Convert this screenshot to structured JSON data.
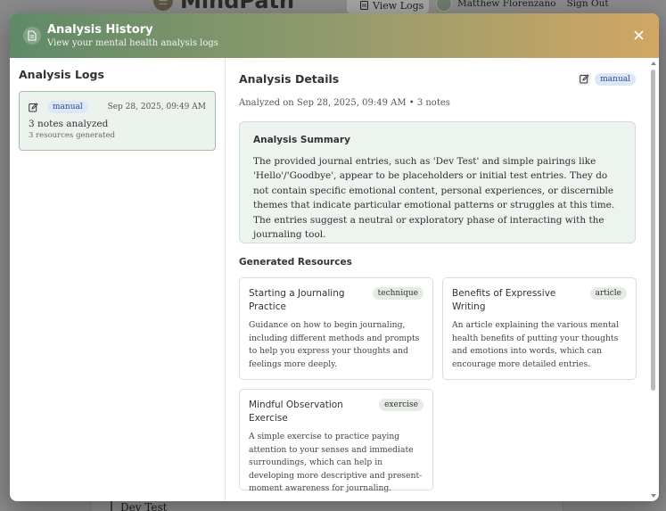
{
  "background": {
    "app_name": "MindPath",
    "view_logs_label": "View Logs",
    "user_name": "Matthew Florenzano",
    "sign_out_label": "Sign Out",
    "entry_title": "Dev Test"
  },
  "modal": {
    "title": "Analysis History",
    "subtitle": "View your mental health analysis logs",
    "close_icon": "close-icon",
    "accent_colors": {
      "header_start": "#5f8a67",
      "header_end": "#d2a764",
      "selected_border": "#9ec1a6"
    }
  },
  "sidebar": {
    "title": "Analysis Logs",
    "logs": [
      {
        "type": "manual",
        "date": "Sep 28, 2025, 09:49 AM",
        "notes_text": "3 notes analyzed",
        "resources_text": "3 resources generated",
        "selected": true
      }
    ]
  },
  "details": {
    "title": "Analysis Details",
    "type_badge": "manual",
    "analyzed_on": "Analyzed on Sep 28, 2025, 09:49 AM • 3 notes",
    "summary_title": "Analysis Summary",
    "summary_text": "The provided journal entries, such as 'Dev Test' and simple pairings like 'Hello'/'Goodbye', appear to be placeholders or initial test entries. They do not contain specific emotional content, personal experiences, or discernible themes that indicate particular emotional patterns or struggles at this time. The entries suggest a neutral or exploratory phase of interacting with the journaling tool.",
    "resources_title": "Generated Resources",
    "resources": [
      {
        "title": "Starting a Journaling Practice",
        "tag": "technique",
        "description": "Guidance on how to begin journaling, including different methods and prompts to help you express your thoughts and feelings more deeply."
      },
      {
        "title": "Benefits of Expressive Writing",
        "tag": "article",
        "description": "An article explaining the various mental health benefits of putting your thoughts and emotions into words, which can encourage more detailed entries."
      },
      {
        "title": "Mindful Observation Exercise",
        "tag": "exercise",
        "description": "A simple exercise to practice paying attention to your senses and immediate surroundings, which can help in developing more descriptive and present-moment awareness for journaling."
      }
    ]
  }
}
